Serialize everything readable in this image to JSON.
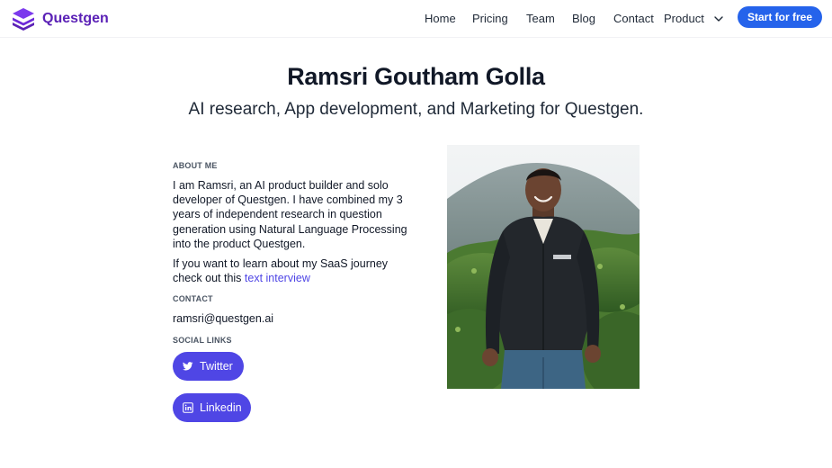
{
  "nav": {
    "brand_name": "Questgen",
    "links": [
      "Home",
      "Pricing",
      "Team",
      "Blog",
      "Contact"
    ],
    "product_label": "Product",
    "cta_label": "Start for free"
  },
  "hero": {
    "title": "Ramsri Goutham Golla",
    "subtitle": "AI research, App development, and Marketing for Questgen."
  },
  "about": {
    "label": "ABOUT ME",
    "paragraph_1": "I am Ramsri, an AI product builder and solo developer of Questgen. I have combined my 3 years of independent research in question generation using Natural Language Processing into the product Questgen.",
    "paragraph_2_text": "If you want to learn about my SaaS journey check out this ",
    "paragraph_2_link": "text interview"
  },
  "contact": {
    "label": "CONTACT",
    "email": "ramsri@questgen.ai"
  },
  "social": {
    "label": "SOCIAL LINKS",
    "twitter_label": "Twitter",
    "linkedin_label": "Linkedin"
  },
  "icons": {
    "logo": "questgen-logo-icon",
    "chevron": "chevron-down-icon",
    "twitter": "twitter-icon",
    "linkedin": "linkedin-icon"
  },
  "colors": {
    "brand": "#5b21b6",
    "cta": "#2563eb",
    "social_button": "#4f46e5",
    "link": "#4f46e5"
  }
}
